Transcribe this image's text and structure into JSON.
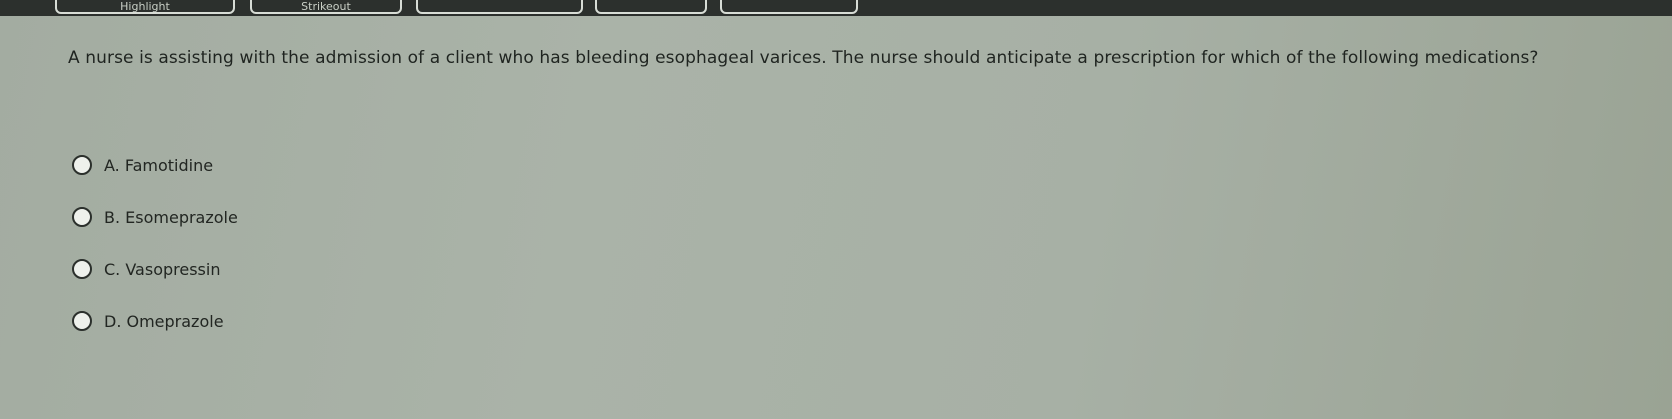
{
  "toolbar": {
    "buttons": [
      {
        "label": "Highlight"
      },
      {
        "label": "Strikeout"
      },
      {
        "label": ""
      },
      {
        "label": ""
      },
      {
        "label": ""
      }
    ]
  },
  "question": {
    "text": "A nurse is assisting with the admission of a client who has bleeding esophageal varices. The nurse should anticipate a prescription for which of the following medications?"
  },
  "options": [
    {
      "label": "A. Famotidine",
      "selected": false
    },
    {
      "label": "B. Esomeprazole",
      "selected": false
    },
    {
      "label": "C. Vasopressin",
      "selected": false
    },
    {
      "label": "D. Omeprazole",
      "selected": false
    }
  ]
}
